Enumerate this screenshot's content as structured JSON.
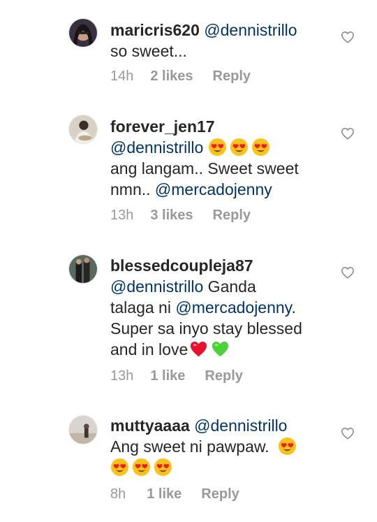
{
  "comments": [
    {
      "username": "maricris620",
      "mention": "@dennistrillo",
      "text1": "so sweet...",
      "time": "14h",
      "likes": "2 likes",
      "reply": "Reply"
    },
    {
      "username": "forever_jen17",
      "mention": "@dennistrillo",
      "emojis": [
        "heart-eyes",
        "heart-eyes",
        "heart-eyes"
      ],
      "text1": "ang langam.. Sweet sweet",
      "text2": "nmn.. ",
      "mention2": "@mercadojenny",
      "time": "13h",
      "likes": "3 likes",
      "reply": "Reply"
    },
    {
      "username": "blessedcoupleja87",
      "mention": "@dennistrillo",
      "text1": " Ganda",
      "text2": "talaga ni ",
      "mention2": "@mercadojenny",
      "text3": ".",
      "text4": "Super sa inyo stay blessed",
      "text5": "and in love",
      "emojis": [
        "red-heart",
        "green-heart"
      ],
      "time": "13h",
      "likes": "1 like",
      "reply": "Reply"
    },
    {
      "username": "muttyaaaa",
      "mention": "@dennistrillo",
      "text1": "Ang sweet ni pawpaw.",
      "emojis": [
        "heart-eyes",
        "heart-eyes",
        "heart-eyes",
        "heart-eyes"
      ],
      "time": "8h",
      "likes": "1 like",
      "reply": "Reply"
    }
  ],
  "colors": {
    "mention": "#003569",
    "meta": "#999999",
    "text": "#262626"
  },
  "icons": {
    "like": "heart-outline-icon"
  }
}
